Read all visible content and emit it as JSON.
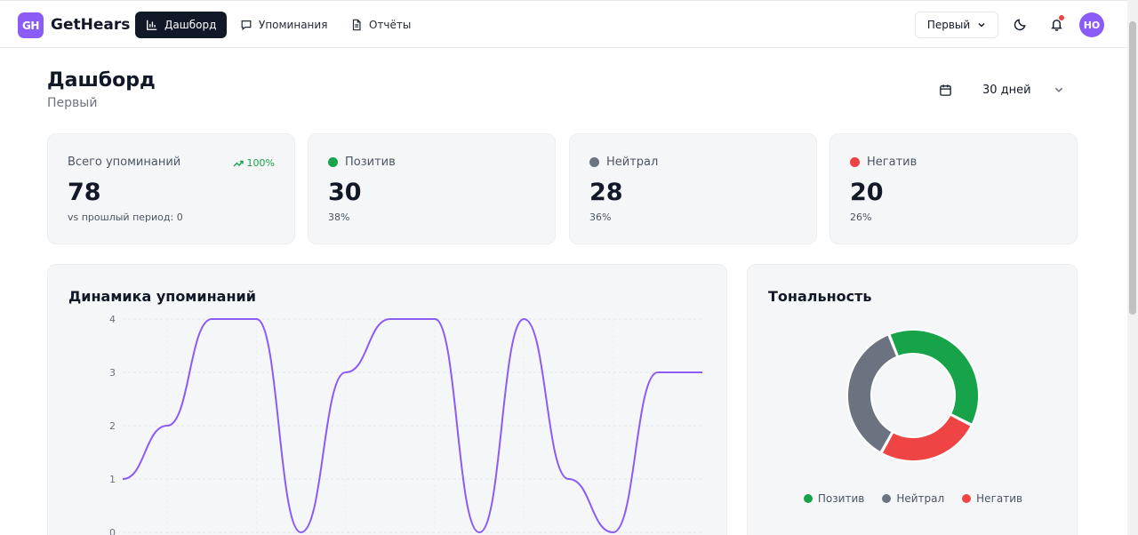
{
  "app": {
    "logo_initials": "GH",
    "name": "GetHears"
  },
  "nav": [
    {
      "label": "Дашборд",
      "icon": "bar-chart-icon",
      "active": true
    },
    {
      "label": "Упоминания",
      "icon": "message-icon",
      "active": false
    },
    {
      "label": "Отчёты",
      "icon": "document-icon",
      "active": false
    }
  ],
  "topbar": {
    "project": "Первый",
    "avatar_initials": "НО",
    "has_notification": true
  },
  "header": {
    "title": "Дашборд",
    "subtitle": "Первый",
    "period": "30 дней"
  },
  "stats": {
    "total": {
      "label": "Всего упоминаний",
      "value": "78",
      "trend": "100%",
      "sub": "vs прошлый период: 0"
    },
    "positive": {
      "label": "Позитив",
      "value": "30",
      "sub": "38%",
      "color": "#16a34a"
    },
    "neutral": {
      "label": "Нейтрал",
      "value": "28",
      "sub": "36%",
      "color": "#6b7280"
    },
    "negative": {
      "label": "Негатив",
      "value": "20",
      "sub": "26%",
      "color": "#ef4444"
    }
  },
  "dynamics": {
    "title": "Динамика упоминаний"
  },
  "tonality": {
    "title": "Тональность"
  },
  "chart_data": [
    {
      "type": "line",
      "title": "Динамика упоминаний",
      "ylim": [
        0,
        4
      ],
      "y_ticks": [
        0,
        1,
        2,
        3,
        4
      ],
      "color": "#8b5cf6",
      "grid": true,
      "values": [
        1,
        2,
        4,
        4,
        0,
        3,
        4,
        4,
        0,
        4,
        1,
        0,
        3,
        3
      ]
    },
    {
      "type": "pie",
      "title": "Тональность",
      "donut": true,
      "legend": "bottom",
      "series": [
        {
          "name": "Позитив",
          "value": 30,
          "color": "#16a34a"
        },
        {
          "name": "Негатив",
          "value": 20,
          "color": "#ef4444"
        },
        {
          "name": "Нейтрал",
          "value": 28,
          "color": "#6b7280"
        }
      ]
    }
  ]
}
